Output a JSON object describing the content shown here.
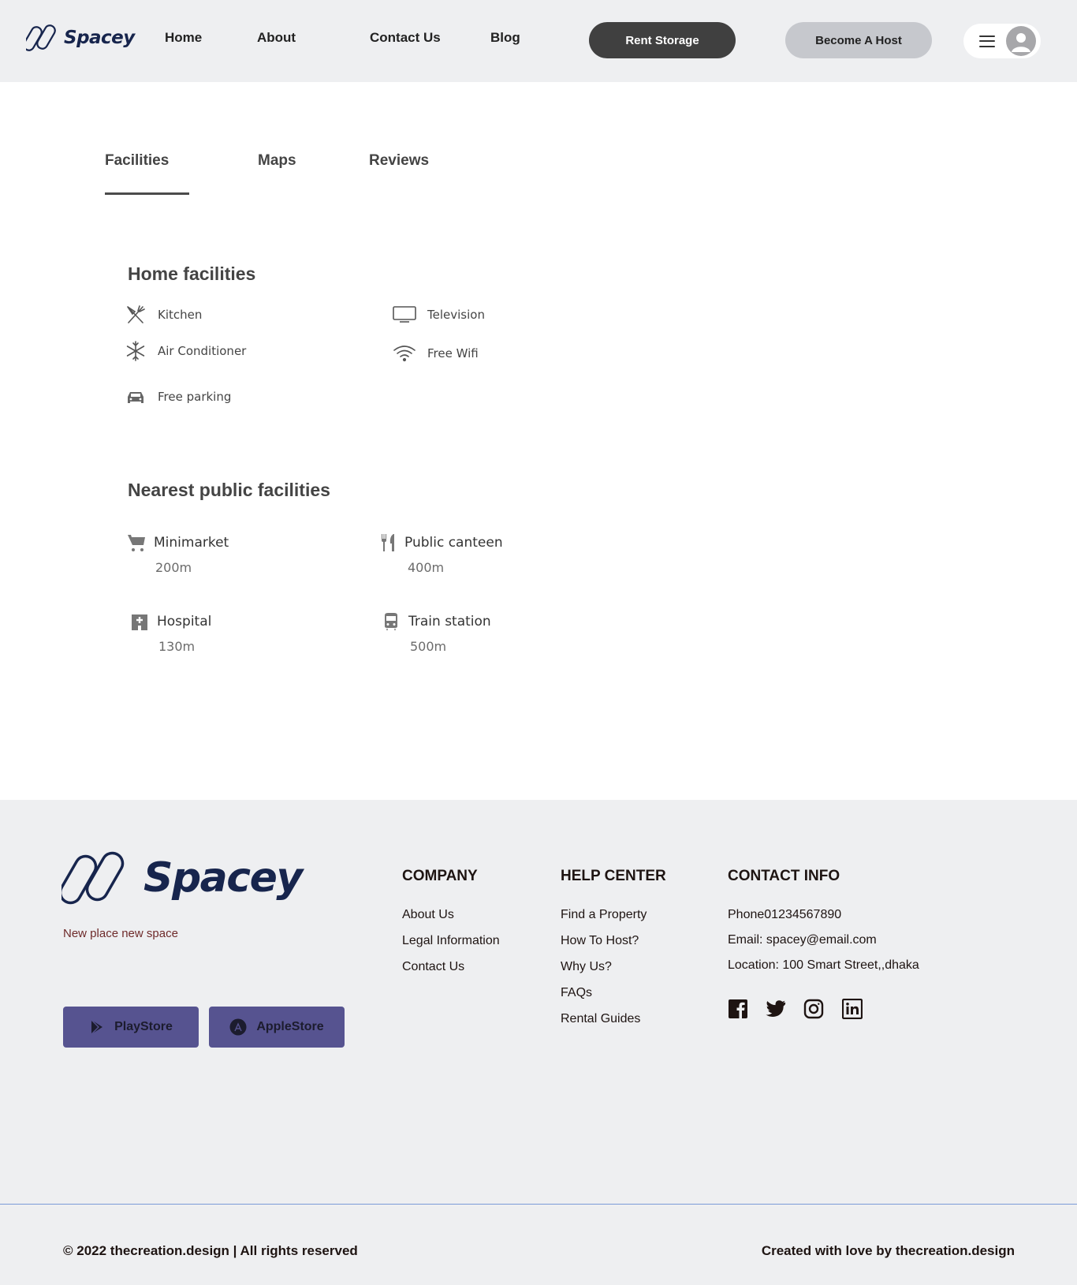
{
  "header": {
    "brand": "Spacey",
    "nav": [
      {
        "label": "Home"
      },
      {
        "label": "About"
      },
      {
        "label": "Contact Us"
      },
      {
        "label": "Blog"
      }
    ],
    "rent_storage_label": "Rent Storage",
    "become_host_label": "Become A Host"
  },
  "tabs": [
    {
      "label": "Facilities",
      "active": true
    },
    {
      "label": "Maps",
      "active": false
    },
    {
      "label": "Reviews",
      "active": false
    }
  ],
  "home_facilities": {
    "title": "Home facilities",
    "items": [
      {
        "label": "Kitchen",
        "icon": "kitchen-icon"
      },
      {
        "label": "Television",
        "icon": "television-icon"
      },
      {
        "label": "Air Conditioner",
        "icon": "snowflake-icon"
      },
      {
        "label": "Free Wifi",
        "icon": "wifi-icon"
      },
      {
        "label": "Free parking",
        "icon": "car-icon"
      }
    ]
  },
  "public_facilities": {
    "title": "Nearest public facilities",
    "items": [
      {
        "name": "Minimarket",
        "distance": "200m",
        "icon": "cart-icon"
      },
      {
        "name": "Public canteen",
        "distance": "400m",
        "icon": "utensils-icon"
      },
      {
        "name": "Hospital",
        "distance": "130m",
        "icon": "hospital-icon"
      },
      {
        "name": "Train station",
        "distance": "500m",
        "icon": "train-icon"
      }
    ]
  },
  "footer": {
    "brand": "Spacey",
    "tagline": "New place new  space",
    "stores": [
      {
        "label": "PlayStore",
        "icon": "play-store-icon"
      },
      {
        "label": "AppleStore",
        "icon": "app-store-icon"
      }
    ],
    "company": {
      "title": "COMPANY",
      "links": [
        "About Us",
        "Legal Information",
        "Contact Us"
      ]
    },
    "help": {
      "title": "HELP CENTER",
      "links": [
        "Find a Property",
        "How To Host?",
        "Why Us?",
        "FAQs",
        "Rental Guides"
      ]
    },
    "contact": {
      "title": "CONTACT INFO",
      "lines": [
        "Phone01234567890",
        "Email: spacey@email.com",
        "Location: 100 Smart Street,,dhaka"
      ]
    },
    "social": [
      "facebook-icon",
      "twitter-icon",
      "instagram-icon",
      "linkedin-icon"
    ],
    "copyright": "© 2022 thecreation.design | All rights reserved",
    "credit_prefix": "Created with love by ",
    "credit_name": "thecreation.design"
  },
  "colors": {
    "brand_navy": "#17254d",
    "header_bg": "#eeeff1",
    "rent_btn": "#404040",
    "host_btn": "#c6c8cd",
    "store_btn": "#565390"
  }
}
